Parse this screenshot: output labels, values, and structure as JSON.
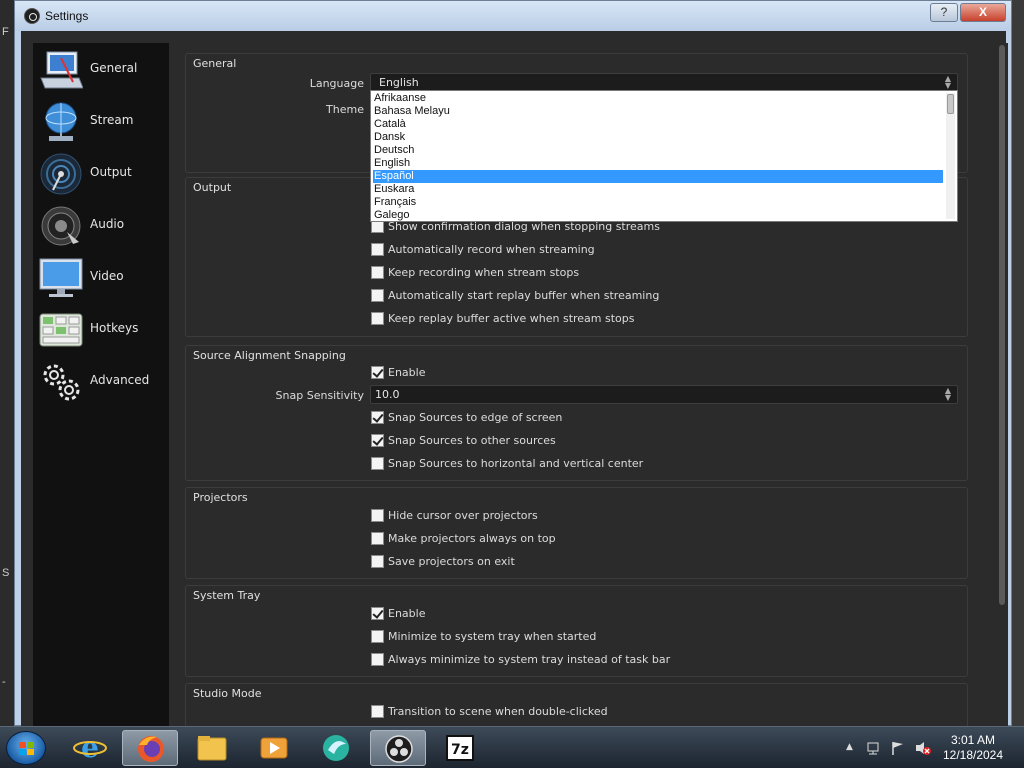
{
  "window": {
    "title": "Settings",
    "help_label": "?",
    "close_label": "X"
  },
  "background": {
    "frag_top": "F",
    "frag_mid": "S",
    "frag_bot": "-"
  },
  "sidebar": {
    "items": [
      {
        "label": "General",
        "icon": "general-icon"
      },
      {
        "label": "Stream",
        "icon": "stream-icon"
      },
      {
        "label": "Output",
        "icon": "output-icon"
      },
      {
        "label": "Audio",
        "icon": "audio-icon"
      },
      {
        "label": "Video",
        "icon": "video-icon"
      },
      {
        "label": "Hotkeys",
        "icon": "hotkeys-icon"
      },
      {
        "label": "Advanced",
        "icon": "advanced-icon"
      }
    ]
  },
  "general": {
    "title": "General",
    "language_label": "Language",
    "language_value": "English",
    "theme_label": "Theme",
    "language_options": [
      "Afrikaanse",
      "Bahasa Melayu",
      "Català",
      "Dansk",
      "Deutsch",
      "English",
      "Español",
      "Euskara",
      "Français",
      "Galego"
    ],
    "highlighted_option": "Español"
  },
  "output": {
    "title": "Output",
    "options": [
      {
        "label": "Show confirmation dialog when stopping streams",
        "checked": false
      },
      {
        "label": "Automatically record when streaming",
        "checked": false
      },
      {
        "label": "Keep recording when stream stops",
        "checked": false
      },
      {
        "label": "Automatically start replay buffer when streaming",
        "checked": false
      },
      {
        "label": "Keep replay buffer active when stream stops",
        "checked": false
      }
    ]
  },
  "snapping": {
    "title": "Source Alignment Snapping",
    "enable_label": "Enable",
    "enable_checked": true,
    "sensitivity_label": "Snap Sensitivity",
    "sensitivity_value": "10.0",
    "options": [
      {
        "label": "Snap Sources to edge of screen",
        "checked": true
      },
      {
        "label": "Snap Sources to other sources",
        "checked": true
      },
      {
        "label": "Snap Sources to horizontal and vertical center",
        "checked": false
      }
    ]
  },
  "projectors": {
    "title": "Projectors",
    "options": [
      {
        "label": "Hide cursor over projectors",
        "checked": false
      },
      {
        "label": "Make projectors always on top",
        "checked": false
      },
      {
        "label": "Save projectors on exit",
        "checked": false
      }
    ]
  },
  "system_tray": {
    "title": "System Tray",
    "options": [
      {
        "label": "Enable",
        "checked": true
      },
      {
        "label": "Minimize to system tray when started",
        "checked": false
      },
      {
        "label": "Always minimize to system tray instead of task bar",
        "checked": false
      }
    ]
  },
  "studio_mode": {
    "title": "Studio Mode",
    "options": [
      {
        "label": "Transition to scene when double-clicked",
        "checked": false
      }
    ]
  },
  "taskbar": {
    "apps": [
      "internet-explorer-icon",
      "firefox-icon",
      "file-explorer-icon",
      "media-player-icon",
      "browser-icon",
      "obs-icon",
      "7zip-icon"
    ],
    "sevenzip_label": "7z",
    "time": "3:01 AM",
    "date": "12/18/2024",
    "tray_up": "▲"
  }
}
